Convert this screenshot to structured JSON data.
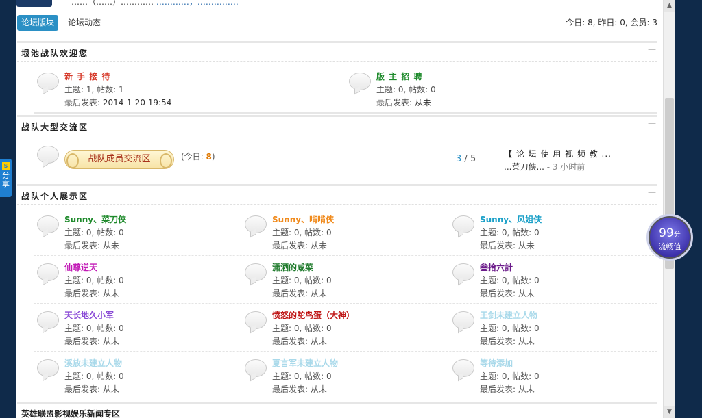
{
  "header": {
    "top_text_a": "……（……）…………",
    "top_text_b": "…………，……………"
  },
  "nav": {
    "tab_active": "论坛版块",
    "tab_other": "论坛动态",
    "stats": "今日: 8, 昨日: 0, 会员: 3"
  },
  "sections": {
    "s1": {
      "title": "垠池战队欢迎您"
    },
    "s2": {
      "title": "战队大型交流区"
    },
    "s3": {
      "title": "战队个人展示区"
    },
    "s4": {
      "title": "英雄联盟影视娱乐新闻专区"
    }
  },
  "forums_s1": [
    {
      "name": "新 手 接 待",
      "color": "#d63a2a",
      "topics": "主题: 1, 帖数: 1",
      "last_label": "最后发表: ",
      "last_value": "2014-1-20 19:54"
    },
    {
      "name": "版 主 招 聘",
      "color": "#1e8a2b",
      "topics": "主题: 0, 帖数: 0",
      "last_label": "最后发表: ",
      "last_value": "从未"
    }
  ],
  "forum_s2": {
    "badge": "战队成员交流区",
    "today_prefix": "(今日: ",
    "today_value": "8",
    "today_suffix": ")",
    "count_a": "3",
    "count_sep": " / ",
    "count_b": "5",
    "last_title": "【 论 坛 使 用 视 频 教 ...",
    "last_user": "...菜刀侠...",
    "last_time": " - 3 小时前"
  },
  "forums_s3": [
    {
      "name": "Sunny、菜刀侠",
      "color": "#1e8a2b",
      "topics": "主题: 0, 帖数: 0",
      "last": "最后发表: 从未"
    },
    {
      "name": "Sunny、啃啃侠",
      "color": "#f08a1c",
      "topics": "主题: 0, 帖数: 0",
      "last": "最后发表: 从未"
    },
    {
      "name": "Sunny、风姐侠",
      "color": "#1aa0c8",
      "topics": "主题: 0, 帖数: 0",
      "last": "最后发表: 从未"
    },
    {
      "name": "仙尊逆天",
      "color": "#c21ab6",
      "topics": "主题: 0, 帖数: 0",
      "last": "最后发表: 从未"
    },
    {
      "name": "潇洒的咸菜",
      "color": "#1e7a2b",
      "topics": "主题: 0, 帖数: 0",
      "last": "最后发表: 从未"
    },
    {
      "name": "叁拾六計",
      "color": "#6b1b8a",
      "topics": "主题: 0, 帖数: 0",
      "last": "最后发表: 从未"
    },
    {
      "name": "天长地久小军",
      "color": "#8a4ad6",
      "topics": "主题: 0, 帖数: 0",
      "last": "最后发表: 从未"
    },
    {
      "name": "愤怒的鸵鸟蛋（大神）",
      "color": "#c01818",
      "topics": "主题: 0, 帖数: 0",
      "last": "最后发表: 从未"
    },
    {
      "name": "王剑未建立人物",
      "color": "#a9d9ea",
      "topics": "主题: 0, 帖数: 0",
      "last": "最后发表: 从未"
    },
    {
      "name": "溪放未建立人物",
      "color": "#a9d9ea",
      "topics": "主题: 0, 帖数: 0",
      "last": "最后发表: 从未"
    },
    {
      "name": "夏言军未建立人物",
      "color": "#a9d9ea",
      "topics": "主题: 0, 帖数: 0",
      "last": "最后发表: 从未"
    },
    {
      "name": "等待添加",
      "color": "#a9d9ea",
      "topics": "主题: 0, 帖数: 0",
      "last": "最后发表: 从未"
    }
  ],
  "share": {
    "icon_glyph": "S",
    "label_top": "分",
    "label_bottom": "享"
  },
  "flow": {
    "value": "99",
    "unit": "分",
    "label": "流畅值"
  },
  "colors": {
    "accent": "#2b90c5",
    "count_a": "#2b90c5",
    "today_value": "#e07800"
  }
}
